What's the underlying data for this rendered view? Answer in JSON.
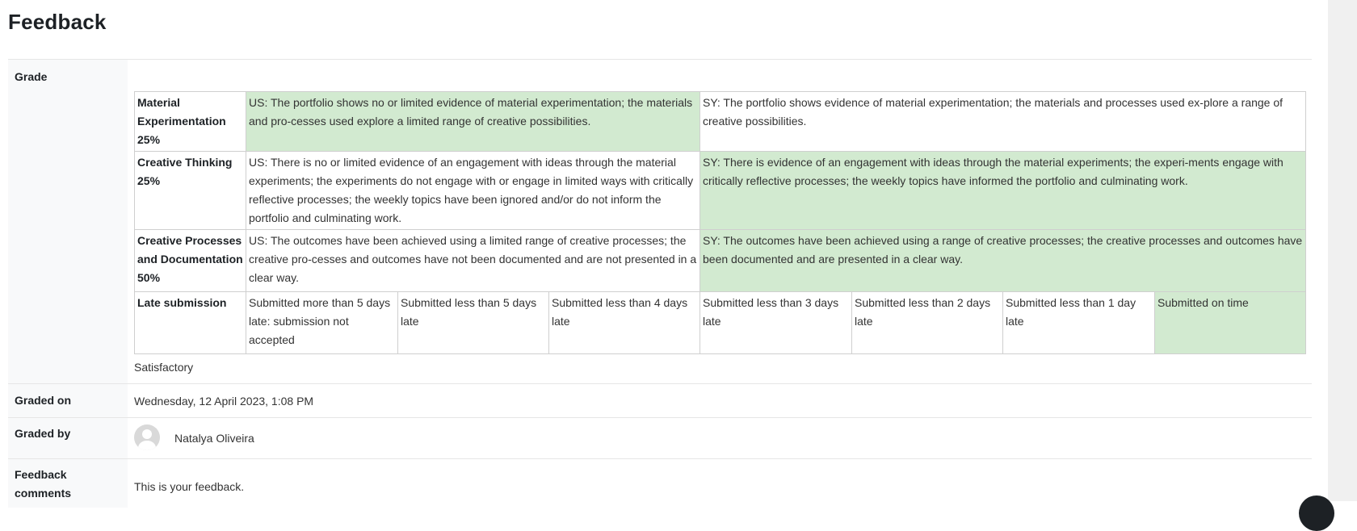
{
  "title": "Feedback",
  "labels": {
    "grade": "Grade",
    "graded_on": "Graded on",
    "graded_by": "Graded by",
    "feedback_comments": "Feedback comments"
  },
  "rubric": {
    "criteria": [
      {
        "name": "Material Experimentation 25%",
        "levels": [
          {
            "text": "US: The portfolio shows no or limited evidence of material experimentation; the materials and pro-cesses used explore a limited range of creative possibilities.",
            "selected": true
          },
          {
            "text": "SY: The portfolio shows evidence of material experimentation; the materials and processes used ex-plore a range of creative possibilities.",
            "selected": false
          }
        ]
      },
      {
        "name": "Creative Thinking 25%",
        "levels": [
          {
            "text": "US: There is no or limited evidence of an engagement with ideas through the material experiments; the experiments do not engage with or engage in limited ways with critically reflective processes; the weekly topics have been ignored and/or do not inform the portfolio and culminating work.",
            "selected": false
          },
          {
            "text": "SY: There is evidence of an engagement with ideas through the material experiments; the experi-ments engage with critically reflective processes; the weekly topics have informed the portfolio and culminating work.",
            "selected": true
          }
        ]
      },
      {
        "name": "Creative Processes and Documentation 50%",
        "levels": [
          {
            "text": "US: The outcomes have been achieved using a limited range of creative processes; the creative pro-cesses and outcomes have not been documented and are not presented in a clear way.",
            "selected": false
          },
          {
            "text": "SY: The outcomes have been achieved using a range of creative processes; the creative processes and outcomes have been documented and are presented in a clear way.",
            "selected": true
          }
        ]
      },
      {
        "name": "Late submission",
        "levels": [
          {
            "text": "Submitted more than 5 days late: submission not accepted",
            "selected": false
          },
          {
            "text": "Submitted less than 5 days late",
            "selected": false
          },
          {
            "text": "Submitted less than 4 days late",
            "selected": false
          },
          {
            "text": "Submitted less than 3 days late",
            "selected": false
          },
          {
            "text": "Submitted less than 2 days late",
            "selected": false
          },
          {
            "text": "Submitted less than 1 day late",
            "selected": false
          },
          {
            "text": "Submitted on time",
            "selected": true
          }
        ]
      }
    ],
    "selected_color": "#d2ead0"
  },
  "grade_value": "Satisfactory",
  "graded_on_value": "Wednesday, 12 April 2023, 1:08 PM",
  "grader": {
    "name": "Natalya Oliveira",
    "avatar_icon": "user-avatar-icon"
  },
  "feedback_comment": "This is your feedback."
}
